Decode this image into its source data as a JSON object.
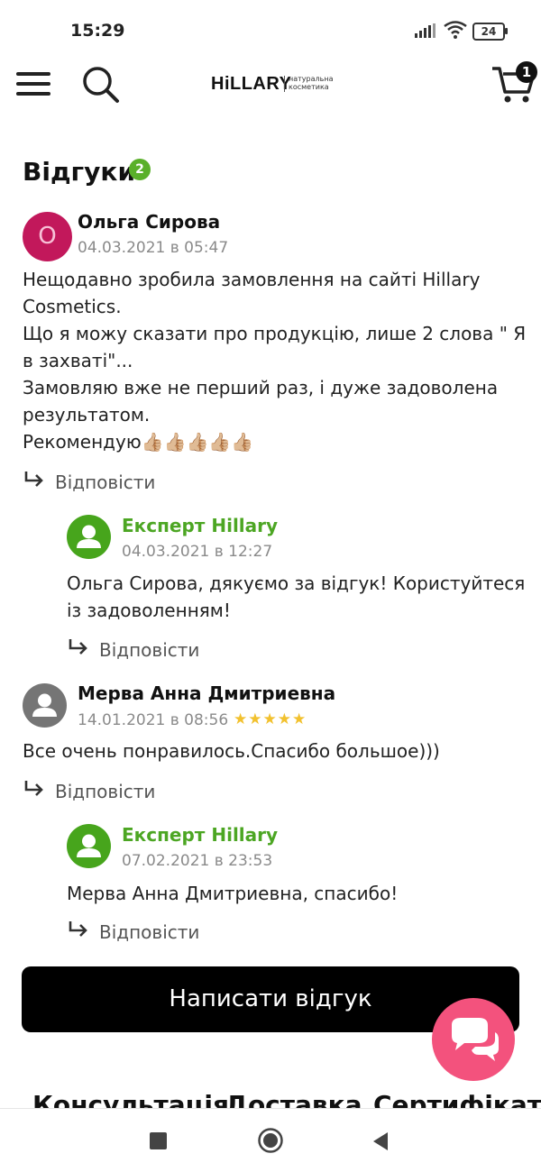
{
  "status_bar": {
    "time": "15:29",
    "battery": "24"
  },
  "header": {
    "logo": "HiLLARY",
    "logo_tag_line1": "натуральна",
    "logo_tag_line2": "косметика",
    "cart_count": "1"
  },
  "reviews_section": {
    "title": "Відгуки",
    "count": "2"
  },
  "reviews": [
    {
      "initial": "О",
      "author": "Ольга Сирова",
      "date": "04.03.2021 в 05:47",
      "lines": [
        "Нещодавно зробила замовлення на сайті Hillary",
        "Cosmetics.",
        "Що я можу сказати про продукцію, лише 2 слова \" Я",
        "в захваті\"...",
        "Замовляю вже не перший раз, і дуже задоволена",
        "результатом.",
        "Рекомендую👍🏼👍🏼👍🏼👍🏼👍🏼"
      ],
      "reply_label": "Відповісти",
      "answer": {
        "author": "Експерт Hillary",
        "date": "04.03.2021 в 12:27",
        "lines": [
          "Ольга Сирова, дякуємо за відгук! Користуйтеся",
          "із задоволенням!"
        ],
        "reply_label": "Відповісти"
      }
    },
    {
      "author": "Мерва Анна Дмитриевна",
      "date": "14.01.2021 в 08:56",
      "rating": 5,
      "stars": "★★★★★",
      "lines": [
        "Все очень понравилось.Спасибо большое)))"
      ],
      "reply_label": "Відповісти",
      "answer": {
        "author": "Експерт Hillary",
        "date": "07.02.2021 в 23:53",
        "lines": [
          "Мерва Анна Дмитриевна, спасибо!"
        ],
        "reply_label": "Відповісти"
      }
    }
  ],
  "write_review_label": "Написати відгук",
  "bottom_tabs": [
    "Консультація",
    "Доставка",
    "Сертифікат"
  ],
  "colors": {
    "accent_green": "#4ca623",
    "chat_pink": "#f3527d",
    "avatar_magenta": "#c2185b"
  }
}
